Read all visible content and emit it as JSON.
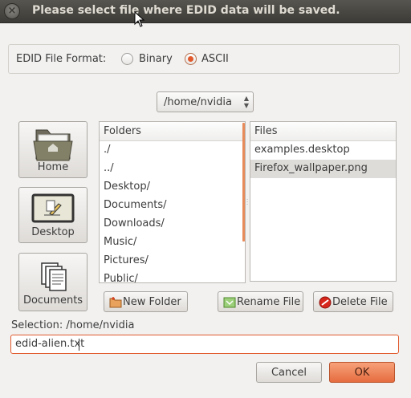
{
  "window": {
    "title": "Please select file where EDID data will be saved.",
    "close_glyph": "×"
  },
  "format": {
    "label": "EDID File Format:",
    "options": [
      {
        "label": "Binary",
        "checked": false
      },
      {
        "label": "ASCII",
        "checked": true
      }
    ]
  },
  "path_combo": {
    "value": "/home/nvidia"
  },
  "places": [
    {
      "label": "Home",
      "icon": "home-folder-icon"
    },
    {
      "label": "Desktop",
      "icon": "desktop-icon"
    },
    {
      "label": "Documents",
      "icon": "documents-icon"
    }
  ],
  "folders": {
    "header": "Folders",
    "items": [
      "./",
      "../",
      "Desktop/",
      "Documents/",
      "Downloads/",
      "Music/",
      "Pictures/",
      "Public/"
    ]
  },
  "files": {
    "header": "Files",
    "items": [
      "examples.desktop",
      "Firefox_wallpaper.png"
    ],
    "selected_index": 1
  },
  "actions": {
    "new_folder": "New Folder",
    "rename_file": "Rename File",
    "delete_file": "Delete File"
  },
  "selection": {
    "label": "Selection: /home/nvidia",
    "value": "edid-alien.txt"
  },
  "dialog_buttons": {
    "cancel": "Cancel",
    "ok": "OK"
  },
  "colors": {
    "accent": "#e1592c",
    "titlebar": "#3c3b37"
  }
}
